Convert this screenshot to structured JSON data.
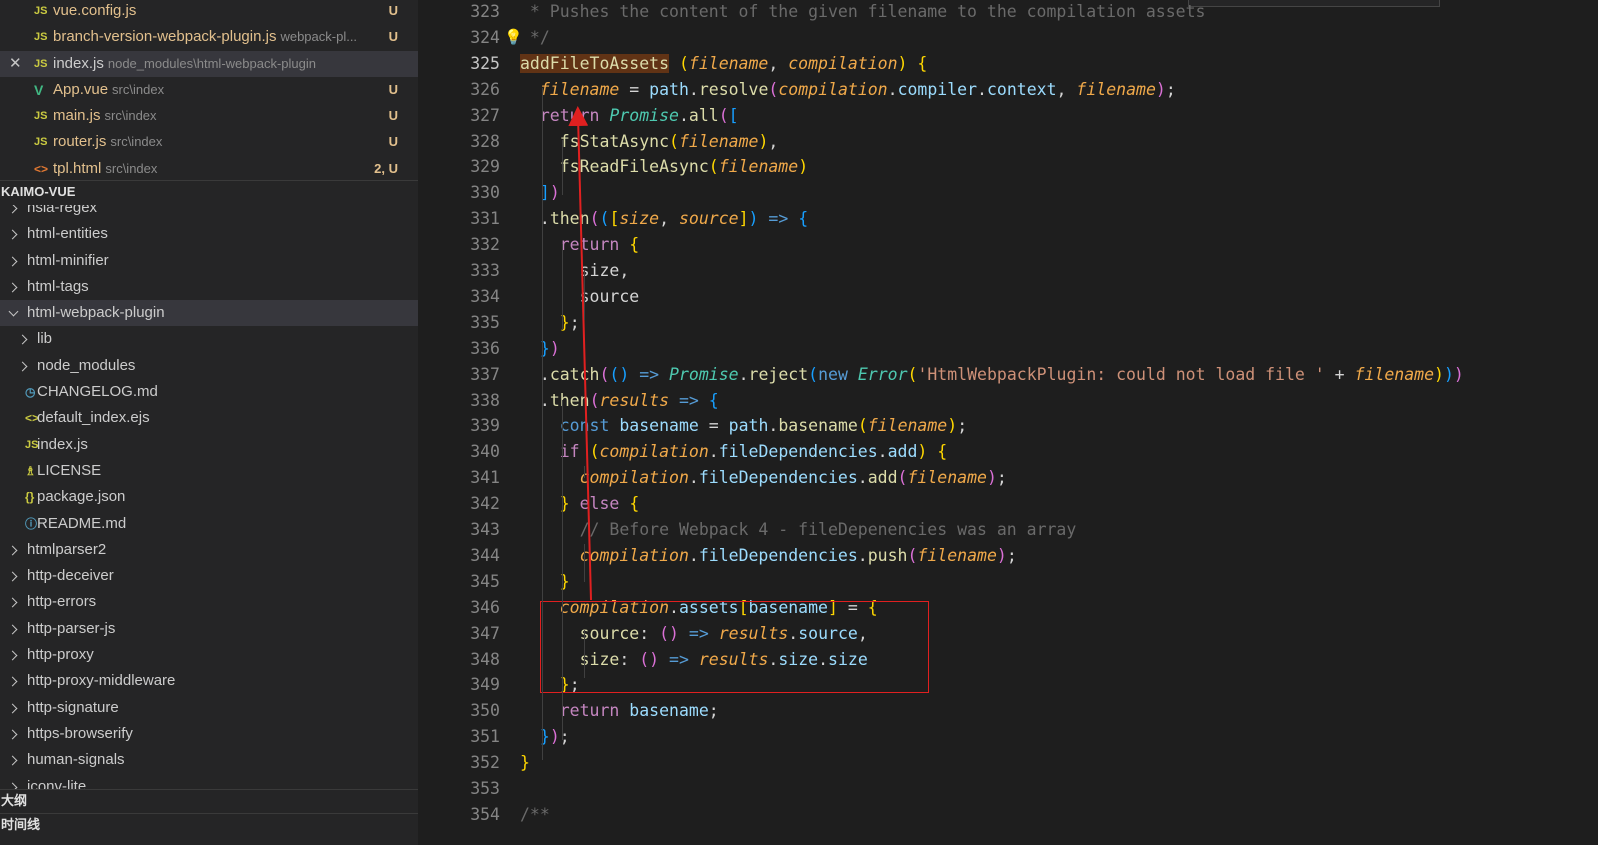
{
  "open_editors": [
    {
      "icon": "JS",
      "name": "vue.config.js",
      "desc": "",
      "status": "U",
      "kind": "js"
    },
    {
      "icon": "JS",
      "name": "branch-version-webpack-plugin.js",
      "desc": "webpack-pl...",
      "status": "U",
      "kind": "js"
    },
    {
      "icon": "JS",
      "name": "index.js",
      "desc": "node_modules\\html-webpack-plugin",
      "status": "",
      "kind": "js",
      "active": true
    },
    {
      "icon": "V",
      "name": "App.vue",
      "desc": "src\\index",
      "status": "U",
      "kind": "vue"
    },
    {
      "icon": "JS",
      "name": "main.js",
      "desc": "src\\index",
      "status": "U",
      "kind": "js"
    },
    {
      "icon": "JS",
      "name": "router.js",
      "desc": "src\\index",
      "status": "U",
      "kind": "js"
    },
    {
      "icon": "<>",
      "name": "tpl.html",
      "desc": "src\\index",
      "status": "2, U",
      "kind": "html"
    }
  ],
  "explorer_title": "KAIMO-VUE",
  "tree": [
    {
      "label": "hsla-regex",
      "depth": 0,
      "type": "folder"
    },
    {
      "label": "html-entities",
      "depth": 0,
      "type": "folder"
    },
    {
      "label": "html-minifier",
      "depth": 0,
      "type": "folder"
    },
    {
      "label": "html-tags",
      "depth": 0,
      "type": "folder"
    },
    {
      "label": "html-webpack-plugin",
      "depth": 0,
      "type": "folder-open",
      "selected": true
    },
    {
      "label": "lib",
      "depth": 1,
      "type": "folder"
    },
    {
      "label": "node_modules",
      "depth": 1,
      "type": "folder"
    },
    {
      "label": "CHANGELOG.md",
      "depth": 1,
      "type": "file",
      "icon": "◷",
      "icon_kind": "md"
    },
    {
      "label": "default_index.ejs",
      "depth": 1,
      "type": "file",
      "icon": "<>",
      "icon_kind": "ejs"
    },
    {
      "label": "index.js",
      "depth": 1,
      "type": "file",
      "icon": "JS",
      "icon_kind": "js"
    },
    {
      "label": "LICENSE",
      "depth": 1,
      "type": "file",
      "icon": "♗",
      "icon_kind": "lic"
    },
    {
      "label": "package.json",
      "depth": 1,
      "type": "file",
      "icon": "{}",
      "icon_kind": "json"
    },
    {
      "label": "README.md",
      "depth": 1,
      "type": "file",
      "icon": "ⓘ",
      "icon_kind": "info"
    },
    {
      "label": "htmlparser2",
      "depth": 0,
      "type": "folder"
    },
    {
      "label": "http-deceiver",
      "depth": 0,
      "type": "folder"
    },
    {
      "label": "http-errors",
      "depth": 0,
      "type": "folder"
    },
    {
      "label": "http-parser-js",
      "depth": 0,
      "type": "folder"
    },
    {
      "label": "http-proxy",
      "depth": 0,
      "type": "folder"
    },
    {
      "label": "http-proxy-middleware",
      "depth": 0,
      "type": "folder"
    },
    {
      "label": "http-signature",
      "depth": 0,
      "type": "folder"
    },
    {
      "label": "https-browserify",
      "depth": 0,
      "type": "folder"
    },
    {
      "label": "human-signals",
      "depth": 0,
      "type": "folder"
    },
    {
      "label": "iconv-lite",
      "depth": 0,
      "type": "folder"
    }
  ],
  "outline_title": "大纲",
  "timeline_title": "时间线",
  "current_line": 325,
  "code_lines": [
    {
      "n": 323,
      "t": [
        [
          "cm-doc",
          " * Pushes the content of the given filename to the compilation assets"
        ]
      ]
    },
    {
      "n": 324,
      "t": [
        [
          "cm-doc",
          " */"
        ]
      ]
    },
    {
      "n": 325,
      "t": [
        [
          "hl",
          "addFileToAssets"
        ],
        [
          "op",
          " "
        ],
        [
          "b1",
          "("
        ],
        [
          "prm",
          "filename"
        ],
        [
          "op",
          ", "
        ],
        [
          "prm",
          "compilation"
        ],
        [
          "b1",
          ")"
        ],
        [
          "op",
          " "
        ],
        [
          "b1",
          "{"
        ]
      ]
    },
    {
      "n": 326,
      "t": [
        [
          "op",
          "  "
        ],
        [
          "prm",
          "filename"
        ],
        [
          "op",
          " = "
        ],
        [
          "prop",
          "path"
        ],
        [
          "op",
          "."
        ],
        [
          "fn",
          "resolve"
        ],
        [
          "b2",
          "("
        ],
        [
          "prm",
          "compilation"
        ],
        [
          "op",
          "."
        ],
        [
          "prop",
          "compiler"
        ],
        [
          "op",
          "."
        ],
        [
          "prop",
          "context"
        ],
        [
          "op",
          ", "
        ],
        [
          "prm",
          "filename"
        ],
        [
          "b2",
          ")"
        ],
        [
          "op",
          ";"
        ]
      ]
    },
    {
      "n": 327,
      "t": [
        [
          "op",
          "  "
        ],
        [
          "kw",
          "return"
        ],
        [
          "op",
          " "
        ],
        [
          "cls",
          "Promise"
        ],
        [
          "op",
          "."
        ],
        [
          "fn",
          "all"
        ],
        [
          "b2",
          "("
        ],
        [
          "b3",
          "["
        ]
      ]
    },
    {
      "n": 328,
      "t": [
        [
          "op",
          "    "
        ],
        [
          "fn",
          "fsStatAsync"
        ],
        [
          "b1",
          "("
        ],
        [
          "prm",
          "filename"
        ],
        [
          "b1",
          ")"
        ],
        [
          "op",
          ","
        ]
      ]
    },
    {
      "n": 329,
      "t": [
        [
          "op",
          "    "
        ],
        [
          "fn",
          "fsReadFileAsync"
        ],
        [
          "b1",
          "("
        ],
        [
          "prm",
          "filename"
        ],
        [
          "b1",
          ")"
        ]
      ]
    },
    {
      "n": 330,
      "t": [
        [
          "op",
          "  "
        ],
        [
          "b3",
          "]"
        ],
        [
          "b2",
          ")"
        ]
      ]
    },
    {
      "n": 331,
      "t": [
        [
          "op",
          "  ."
        ],
        [
          "fn",
          "then"
        ],
        [
          "b2",
          "("
        ],
        [
          "b3",
          "("
        ],
        [
          "b1",
          "["
        ],
        [
          "prm",
          "size"
        ],
        [
          "op",
          ", "
        ],
        [
          "prm",
          "source"
        ],
        [
          "b1",
          "]"
        ],
        [
          "b3",
          ")"
        ],
        [
          "op",
          " "
        ],
        [
          "kw-b",
          "=>"
        ],
        [
          "op",
          " "
        ],
        [
          "b3",
          "{"
        ]
      ]
    },
    {
      "n": 332,
      "t": [
        [
          "op",
          "    "
        ],
        [
          "kw",
          "return"
        ],
        [
          "op",
          " "
        ],
        [
          "b1",
          "{"
        ]
      ]
    },
    {
      "n": 333,
      "t": [
        [
          "op",
          "      "
        ],
        [
          "op",
          "size,"
        ]
      ]
    },
    {
      "n": 334,
      "t": [
        [
          "op",
          "      "
        ],
        [
          "op",
          "source"
        ]
      ]
    },
    {
      "n": 335,
      "t": [
        [
          "op",
          "    "
        ],
        [
          "b1",
          "}"
        ],
        [
          "op",
          ";"
        ]
      ]
    },
    {
      "n": 336,
      "t": [
        [
          "op",
          "  "
        ],
        [
          "b3",
          "}"
        ],
        [
          "b2",
          ")"
        ]
      ]
    },
    {
      "n": 337,
      "t": [
        [
          "op",
          "  ."
        ],
        [
          "fn",
          "catch"
        ],
        [
          "b2",
          "("
        ],
        [
          "b3",
          "("
        ],
        [
          "b3",
          ")"
        ],
        [
          "op",
          " "
        ],
        [
          "kw-b",
          "=>"
        ],
        [
          "op",
          " "
        ],
        [
          "cls",
          "Promise"
        ],
        [
          "op",
          "."
        ],
        [
          "fn",
          "reject"
        ],
        [
          "b3",
          "("
        ],
        [
          "kw-b",
          "new"
        ],
        [
          "op",
          " "
        ],
        [
          "cls",
          "Error"
        ],
        [
          "b1",
          "("
        ],
        [
          "str",
          "'HtmlWebpackPlugin: could not load file '"
        ],
        [
          "op",
          " + "
        ],
        [
          "prm",
          "filename"
        ],
        [
          "b1",
          ")"
        ],
        [
          "b3",
          ")"
        ],
        [
          "b2",
          ")"
        ]
      ]
    },
    {
      "n": 338,
      "t": [
        [
          "op",
          "  ."
        ],
        [
          "fn",
          "then"
        ],
        [
          "b2",
          "("
        ],
        [
          "prm",
          "results"
        ],
        [
          "op",
          " "
        ],
        [
          "kw-b",
          "=>"
        ],
        [
          "op",
          " "
        ],
        [
          "b3",
          "{"
        ]
      ]
    },
    {
      "n": 339,
      "t": [
        [
          "op",
          "    "
        ],
        [
          "kw-b",
          "const"
        ],
        [
          "op",
          " "
        ],
        [
          "prop",
          "basename"
        ],
        [
          "op",
          " = "
        ],
        [
          "prop",
          "path"
        ],
        [
          "op",
          "."
        ],
        [
          "fn",
          "basename"
        ],
        [
          "b1",
          "("
        ],
        [
          "prm",
          "filename"
        ],
        [
          "b1",
          ")"
        ],
        [
          "op",
          ";"
        ]
      ]
    },
    {
      "n": 340,
      "t": [
        [
          "op",
          "    "
        ],
        [
          "kw",
          "if"
        ],
        [
          "op",
          " "
        ],
        [
          "b1",
          "("
        ],
        [
          "prm",
          "compilation"
        ],
        [
          "op",
          "."
        ],
        [
          "prop",
          "fileDependencies"
        ],
        [
          "op",
          "."
        ],
        [
          "prop",
          "add"
        ],
        [
          "b1",
          ")"
        ],
        [
          "op",
          " "
        ],
        [
          "b1",
          "{"
        ]
      ]
    },
    {
      "n": 341,
      "t": [
        [
          "op",
          "      "
        ],
        [
          "prm",
          "compilation"
        ],
        [
          "op",
          "."
        ],
        [
          "prop",
          "fileDependencies"
        ],
        [
          "op",
          "."
        ],
        [
          "fn",
          "add"
        ],
        [
          "b2",
          "("
        ],
        [
          "prm",
          "filename"
        ],
        [
          "b2",
          ")"
        ],
        [
          "op",
          ";"
        ]
      ]
    },
    {
      "n": 342,
      "t": [
        [
          "op",
          "    "
        ],
        [
          "b1",
          "}"
        ],
        [
          "op",
          " "
        ],
        [
          "kw",
          "else"
        ],
        [
          "op",
          " "
        ],
        [
          "b1",
          "{"
        ]
      ]
    },
    {
      "n": 343,
      "t": [
        [
          "op",
          "      "
        ],
        [
          "cm-doc",
          "// Before Webpack 4 - fileDepenencies was an array"
        ]
      ]
    },
    {
      "n": 344,
      "t": [
        [
          "op",
          "      "
        ],
        [
          "prm",
          "compilation"
        ],
        [
          "op",
          "."
        ],
        [
          "prop",
          "fileDependencies"
        ],
        [
          "op",
          "."
        ],
        [
          "fn",
          "push"
        ],
        [
          "b2",
          "("
        ],
        [
          "prm",
          "filename"
        ],
        [
          "b2",
          ")"
        ],
        [
          "op",
          ";"
        ]
      ]
    },
    {
      "n": 345,
      "t": [
        [
          "op",
          "    "
        ],
        [
          "b1",
          "}"
        ]
      ]
    },
    {
      "n": 346,
      "t": [
        [
          "op",
          "    "
        ],
        [
          "prm",
          "compilation"
        ],
        [
          "op",
          "."
        ],
        [
          "prop",
          "assets"
        ],
        [
          "b1",
          "["
        ],
        [
          "prop",
          "basename"
        ],
        [
          "b1",
          "]"
        ],
        [
          "op",
          " = "
        ],
        [
          "b1",
          "{"
        ]
      ]
    },
    {
      "n": 347,
      "t": [
        [
          "op",
          "      "
        ],
        [
          "fn",
          "source"
        ],
        [
          "op",
          ": "
        ],
        [
          "b2",
          "("
        ],
        [
          "b2",
          ")"
        ],
        [
          "op",
          " "
        ],
        [
          "kw-b",
          "=>"
        ],
        [
          "op",
          " "
        ],
        [
          "prm",
          "results"
        ],
        [
          "op",
          "."
        ],
        [
          "prop",
          "source"
        ],
        [
          "op",
          ","
        ]
      ]
    },
    {
      "n": 348,
      "t": [
        [
          "op",
          "      "
        ],
        [
          "fn",
          "size"
        ],
        [
          "op",
          ": "
        ],
        [
          "b2",
          "("
        ],
        [
          "b2",
          ")"
        ],
        [
          "op",
          " "
        ],
        [
          "kw-b",
          "=>"
        ],
        [
          "op",
          " "
        ],
        [
          "prm",
          "results"
        ],
        [
          "op",
          "."
        ],
        [
          "prop",
          "size"
        ],
        [
          "op",
          "."
        ],
        [
          "prop",
          "size"
        ]
      ]
    },
    {
      "n": 349,
      "t": [
        [
          "op",
          "    "
        ],
        [
          "b1",
          "}"
        ],
        [
          "op",
          ";"
        ]
      ]
    },
    {
      "n": 350,
      "t": [
        [
          "op",
          "    "
        ],
        [
          "kw",
          "return"
        ],
        [
          "op",
          " "
        ],
        [
          "prop",
          "basename"
        ],
        [
          "op",
          ";"
        ]
      ]
    },
    {
      "n": 351,
      "t": [
        [
          "op",
          "  "
        ],
        [
          "b3",
          "}"
        ],
        [
          "b2",
          ")"
        ],
        [
          "op",
          ";"
        ]
      ]
    },
    {
      "n": 352,
      "t": [
        [
          "b1",
          "}"
        ]
      ]
    },
    {
      "n": 353,
      "t": []
    },
    {
      "n": 354,
      "t": [
        [
          "cm-doc",
          "/**"
        ]
      ]
    }
  ],
  "colors": {
    "annotation_red": "#e02020",
    "selection_highlight": "#613315",
    "accent_lightbulb": "#ffcc00"
  },
  "icons": {
    "lightbulb": "lightbulb-icon",
    "close": "close-icon",
    "chevron": "chevron-icon"
  }
}
